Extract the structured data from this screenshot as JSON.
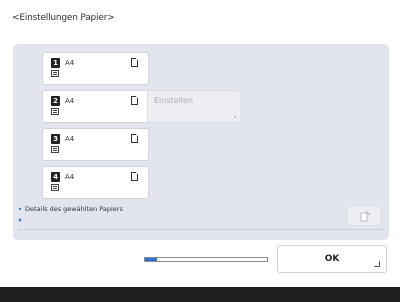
{
  "header": {
    "title": "<Einstellungen Papier>"
  },
  "drawers": [
    {
      "number": "1",
      "size": "A4"
    },
    {
      "number": "2",
      "size": "A4"
    },
    {
      "number": "3",
      "size": "A4"
    },
    {
      "number": "4",
      "size": "A4"
    }
  ],
  "settings_button": {
    "label": "Einstellen"
  },
  "details": {
    "label": "Details des gewählten Papiers"
  },
  "progress": {
    "fraction": 0.1
  },
  "ok_button": {
    "label": "OK"
  },
  "colors": {
    "accent": "#2f6fd1",
    "panel": "#e2e5ee",
    "bottom_bar": "#1e1e1e"
  }
}
